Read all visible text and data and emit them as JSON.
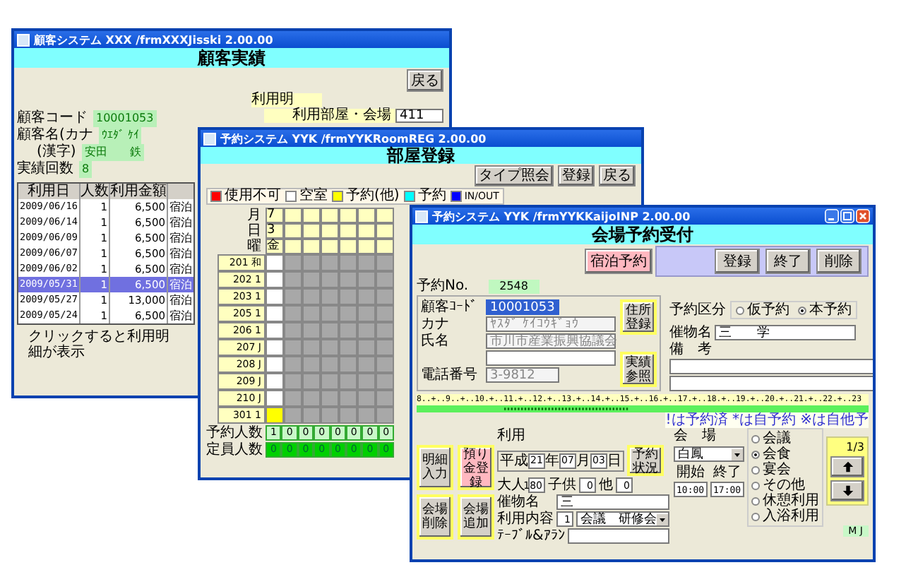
{
  "customer_window": {
    "title": "顧客システム XXX /frmXXXJisski 2.00.00",
    "heading": "顧客実績",
    "back_button": "戻る",
    "usage_label": "利用明",
    "room_label": "利用部屋・会場",
    "room_value": "411",
    "fields": [
      {
        "label": "顧客コード",
        "value": "10001053"
      },
      {
        "label": "顧客名(カナ",
        "value": "ｳｴﾀﾞ ｹｲ"
      },
      {
        "label": "(漢字)",
        "value": "安田　　鉄"
      },
      {
        "label": "実績回数",
        "value": "8"
      }
    ],
    "table": {
      "columns": [
        "利用日",
        "人数",
        "利用金額"
      ],
      "rows": [
        {
          "cells": [
            "2009/06/16",
            "1",
            "6,500",
            "宿泊"
          ],
          "selected": false
        },
        {
          "cells": [
            "2009/06/14",
            "1",
            "6,500",
            "宿泊"
          ],
          "selected": false
        },
        {
          "cells": [
            "2009/06/09",
            "1",
            "6,500",
            "宿泊"
          ],
          "selected": false
        },
        {
          "cells": [
            "2009/06/07",
            "1",
            "6,500",
            "宿泊"
          ],
          "selected": false
        },
        {
          "cells": [
            "2009/06/02",
            "1",
            "6,500",
            "宿泊"
          ],
          "selected": false
        },
        {
          "cells": [
            "2009/05/31",
            "1",
            "6,500",
            "宿泊"
          ],
          "selected": true
        },
        {
          "cells": [
            "2009/05/27",
            "1",
            "13,000",
            "宿泊"
          ],
          "selected": false
        },
        {
          "cells": [
            "2009/05/24",
            "1",
            "6,500",
            "宿泊"
          ],
          "selected": false
        }
      ]
    },
    "hint": "クリックすると利用明細が表示"
  },
  "room_window": {
    "title": "予約システム YYK /frmYYKRoomREG 2.00.00",
    "heading": "部屋登録",
    "buttons": [
      "タイプ照会",
      "登録",
      "戻る"
    ],
    "legend": [
      {
        "label": "使用不可",
        "color": "#ff0000"
      },
      {
        "label": "空室",
        "color": "#ffffff"
      },
      {
        "label": "予約(他)",
        "color": "#ffff00"
      },
      {
        "label": "予約",
        "color": "#00ffff"
      },
      {
        "label": "IN/OUT",
        "color": "#0000ff"
      }
    ],
    "date_header": [
      {
        "label": "月",
        "value": "7"
      },
      {
        "label": "日",
        "value": "3"
      },
      {
        "label": "曜",
        "value": "金"
      }
    ],
    "rooms": [
      {
        "number": "201",
        "type": "和",
        "cells": [
          {
            "color": "#ffffff"
          },
          {
            "color": "#a8a8a8"
          },
          {
            "color": "#a8a8a8"
          },
          {
            "color": "#a8a8a8"
          },
          {
            "color": "#a8a8a8"
          },
          {
            "color": "#a8a8a8"
          },
          {
            "color": "#a8a8a8"
          }
        ]
      },
      {
        "number": "202",
        "type": "1",
        "cells": [
          {
            "color": "#ffffff"
          },
          {
            "color": "#a8a8a8"
          },
          {
            "color": "#a8a8a8"
          },
          {
            "color": "#a8a8a8"
          },
          {
            "color": "#a8a8a8"
          },
          {
            "color": "#a8a8a8"
          },
          {
            "color": "#a8a8a8"
          }
        ]
      },
      {
        "number": "203",
        "type": "1",
        "cells": [
          {
            "color": "#ffffff"
          },
          {
            "color": "#a8a8a8"
          },
          {
            "color": "#a8a8a8"
          },
          {
            "color": "#a8a8a8"
          },
          {
            "color": "#a8a8a8"
          },
          {
            "color": "#a8a8a8"
          },
          {
            "color": "#a8a8a8"
          }
        ]
      },
      {
        "number": "205",
        "type": "1",
        "cells": [
          {
            "color": "#ffffff"
          },
          {
            "color": "#a8a8a8"
          },
          {
            "color": "#a8a8a8"
          },
          {
            "color": "#a8a8a8"
          },
          {
            "color": "#a8a8a8"
          },
          {
            "color": "#a8a8a8"
          },
          {
            "color": "#a8a8a8"
          }
        ]
      },
      {
        "number": "206",
        "type": "1",
        "cells": [
          {
            "color": "#ffffff"
          },
          {
            "color": "#a8a8a8"
          },
          {
            "color": "#a8a8a8"
          },
          {
            "color": "#a8a8a8"
          },
          {
            "color": "#a8a8a8"
          },
          {
            "color": "#a8a8a8"
          },
          {
            "color": "#a8a8a8"
          }
        ]
      },
      {
        "number": "207",
        "type": "J",
        "cells": [
          {
            "color": "#ffffff"
          },
          {
            "color": "#a8a8a8"
          },
          {
            "color": "#a8a8a8"
          },
          {
            "color": "#a8a8a8"
          },
          {
            "color": "#a8a8a8"
          },
          {
            "color": "#a8a8a8"
          },
          {
            "color": "#a8a8a8"
          }
        ]
      },
      {
        "number": "208",
        "type": "J",
        "cells": [
          {
            "color": "#ffffff"
          },
          {
            "color": "#a8a8a8"
          },
          {
            "color": "#a8a8a8"
          },
          {
            "color": "#a8a8a8"
          },
          {
            "color": "#a8a8a8"
          },
          {
            "color": "#a8a8a8"
          },
          {
            "color": "#a8a8a8"
          }
        ]
      },
      {
        "number": "209",
        "type": "J",
        "cells": [
          {
            "color": "#ffffff"
          },
          {
            "color": "#a8a8a8"
          },
          {
            "color": "#a8a8a8"
          },
          {
            "color": "#a8a8a8"
          },
          {
            "color": "#a8a8a8"
          },
          {
            "color": "#a8a8a8"
          },
          {
            "color": "#a8a8a8"
          }
        ]
      },
      {
        "number": "210",
        "type": "J",
        "cells": [
          {
            "color": "#ffffff"
          },
          {
            "color": "#a8a8a8"
          },
          {
            "color": "#a8a8a8"
          },
          {
            "color": "#a8a8a8"
          },
          {
            "color": "#a8a8a8"
          },
          {
            "color": "#a8a8a8"
          },
          {
            "color": "#a8a8a8"
          }
        ]
      },
      {
        "number": "301",
        "type": "1",
        "cells": [
          {
            "color": "#ffff00"
          },
          {
            "color": "#a8a8a8"
          },
          {
            "color": "#a8a8a8"
          },
          {
            "color": "#a8a8a8"
          },
          {
            "color": "#a8a8a8"
          },
          {
            "color": "#a8a8a8"
          },
          {
            "color": "#a8a8a8"
          }
        ]
      }
    ],
    "totals": [
      {
        "label": "予約人数",
        "values": [
          "1",
          "0",
          "0",
          "0",
          "0",
          "0",
          "0",
          "0"
        ]
      },
      {
        "label": "定員人数",
        "values": [
          "0",
          "0",
          "0",
          "0",
          "0",
          "0",
          "0",
          "0"
        ]
      }
    ]
  },
  "booking_window": {
    "title": "予約システム YYK /frmYYKKaijoINP 2.00.00",
    "heading": "会場予約受付",
    "lodging_button": "宿泊予約",
    "actions": [
      "登録",
      "終了",
      "削除"
    ],
    "reservation_no_label": "予約No.",
    "reservation_no": "2548",
    "customer": {
      "code_label": "顧客ｺｰﾄﾞ",
      "code": "10001053",
      "kana_label": "カナ",
      "kana": "ﾔｽﾀﾞ ｹｲｺｳｷﾞｮｳ",
      "name_label": "氏名",
      "name": "市川市産業振興協議会",
      "phone_label": "電話番号",
      "phone": "3-9812",
      "address_button": "住所登録",
      "history_button": "実績参照"
    },
    "booking_type": {
      "label": "予約区分",
      "options": [
        {
          "label": "仮予約",
          "selected": false
        },
        {
          "label": "本予約",
          "selected": true
        }
      ]
    },
    "event_label": "催物名",
    "event_name": "三　　学",
    "notes_label": "備　考",
    "timeline": {
      "scale": "8..+..9..+..10.+..11.+..12.+..13.+..14.+..15.+..16.+..17.+..18.+..19.+..20.+..21.+..22.+..23",
      "legend": "!は予約済 *は自予約 ※は自他予"
    },
    "side_buttons": [
      {
        "label": "明細入力",
        "highlight": false
      },
      {
        "label": "預り金登録",
        "highlight": true
      },
      {
        "label": "会場削除",
        "highlight": false
      },
      {
        "label": "会場追加",
        "highlight": false
      }
    ],
    "usage": {
      "label": "利用",
      "era": "平成",
      "year": "21",
      "year_unit": "年",
      "month": "07",
      "month_unit": "月",
      "day": "03",
      "day_unit": "日",
      "status_button": "予約状況",
      "adults_label": "大人",
      "adults": "180",
      "children_label": "子供",
      "children": "0",
      "others_label": "他",
      "others": "0",
      "event_label": "催物名",
      "event": "三",
      "purpose_label": "利用内容",
      "purpose_code": "1",
      "purpose": "会議　研修会",
      "layout_label": "ﾃｰﾌﾞﾙ&ｱﾗﾝ"
    },
    "venue": {
      "label": "会　場",
      "value": "白鳳",
      "start_label": "開始",
      "end_label": "終了",
      "start": "10:00",
      "end": "17:00"
    },
    "venue_types": [
      {
        "label": "会議",
        "selected": false
      },
      {
        "label": "会食",
        "selected": true
      },
      {
        "label": "宴会",
        "selected": false
      },
      {
        "label": "その他",
        "selected": false
      },
      {
        "label": "休憩利用",
        "selected": false
      },
      {
        "label": "入浴利用",
        "selected": false
      }
    ],
    "page": "1/3",
    "operator": "M J"
  }
}
